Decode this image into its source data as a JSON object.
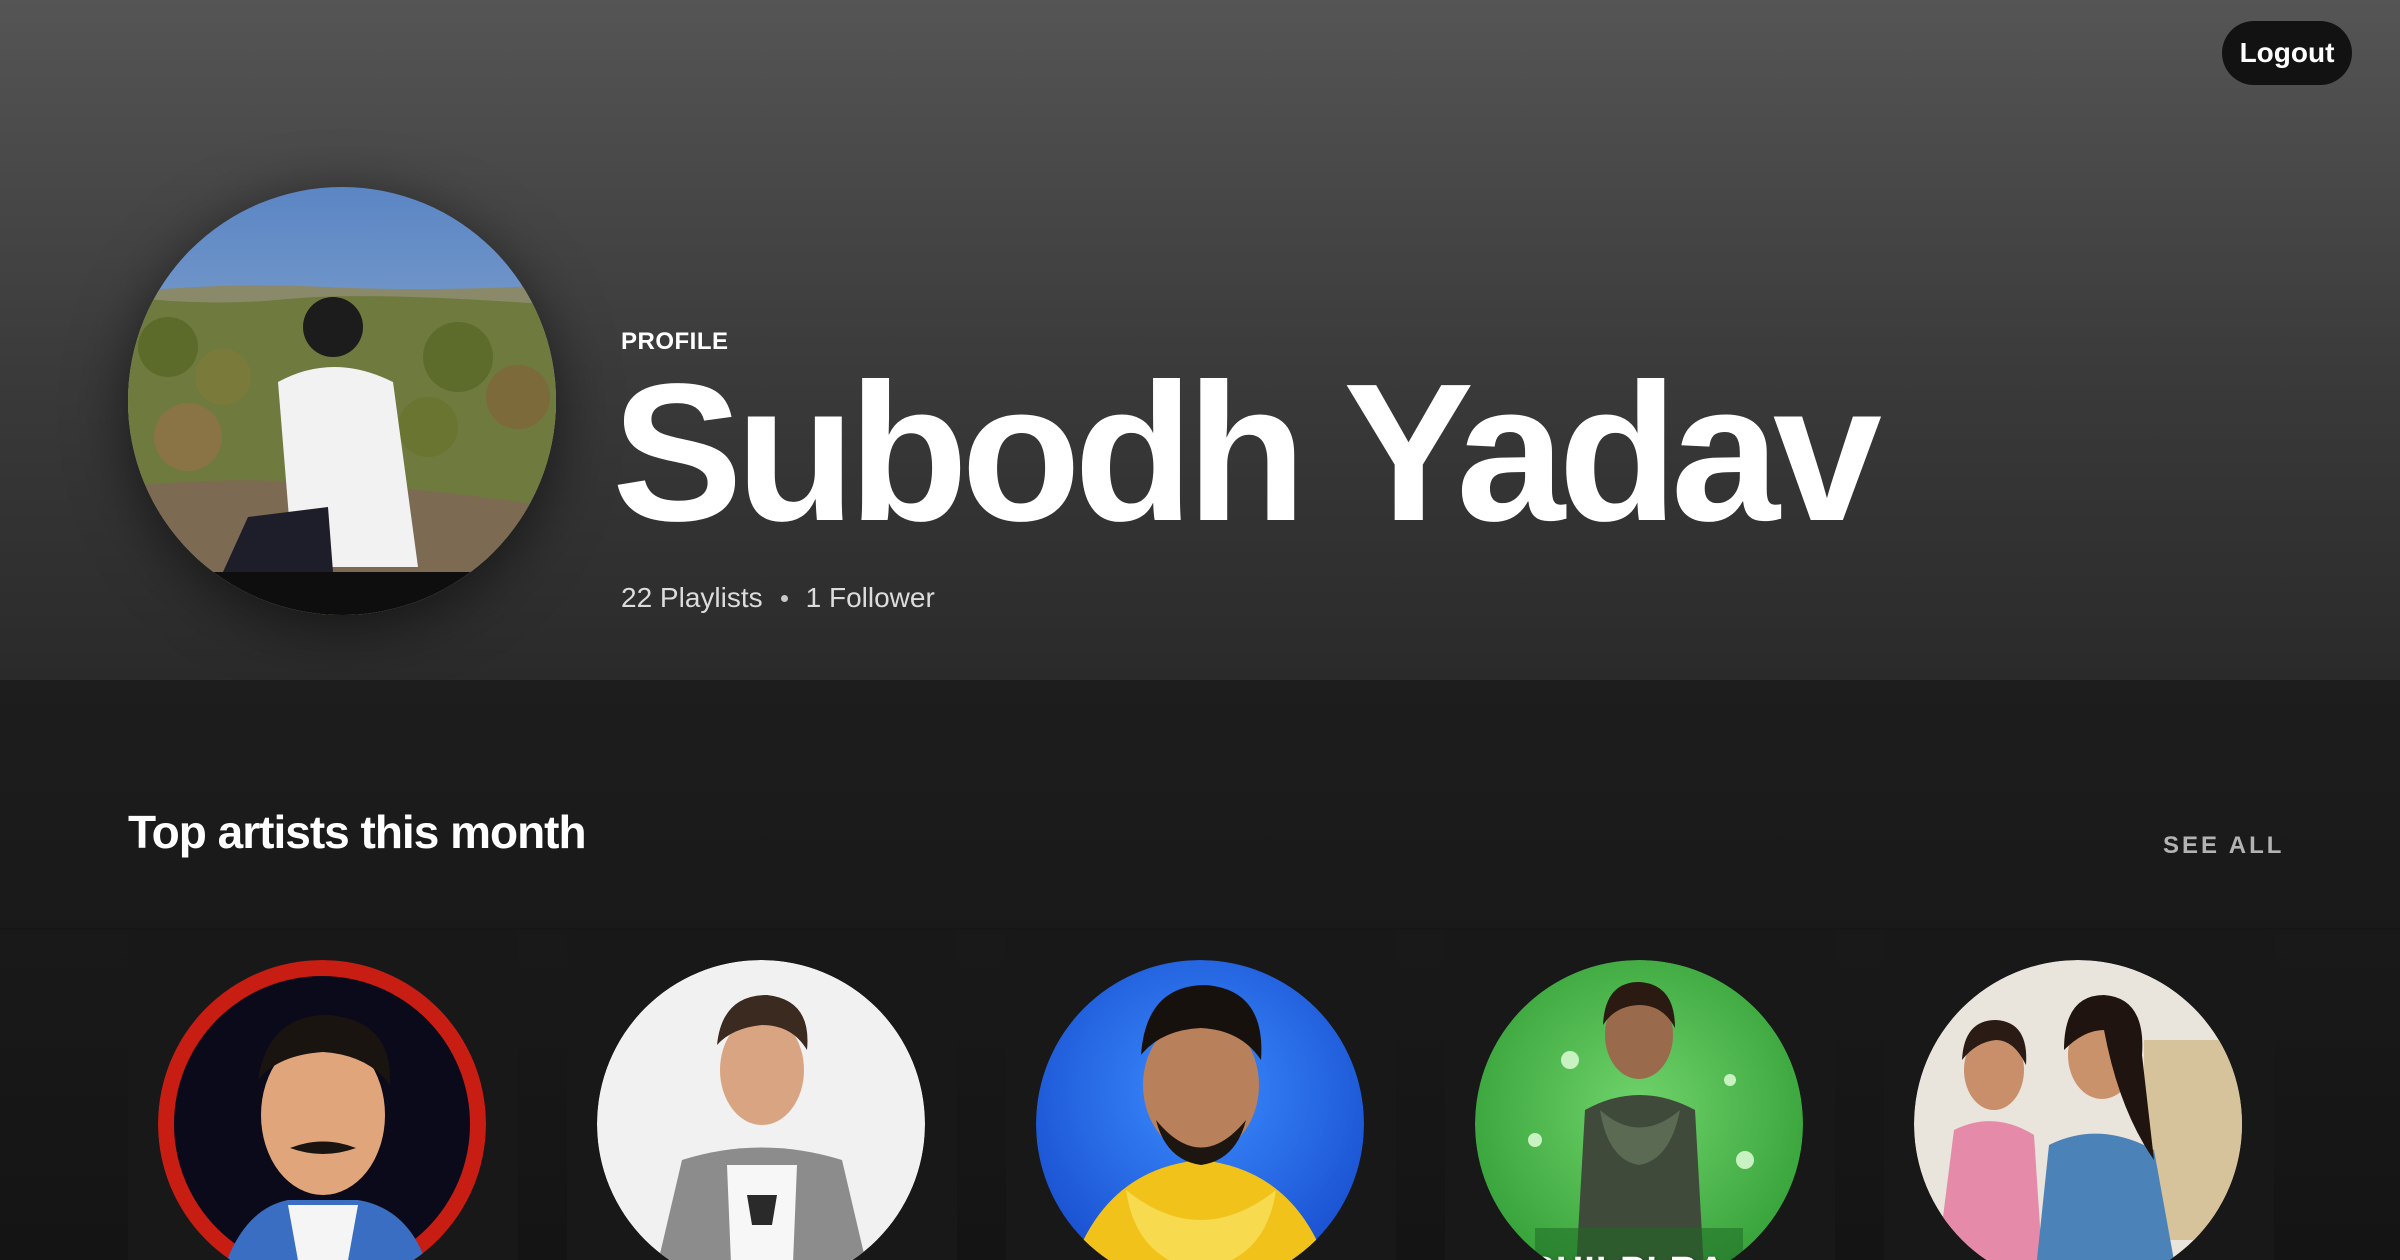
{
  "header": {
    "logout_label": "Logout"
  },
  "profile": {
    "label": "PROFILE",
    "name": "Subodh Yadav",
    "playlists": "22 Playlists",
    "followers": "1 Follower"
  },
  "top_artists": {
    "title": "Top artists this month",
    "see_all_label": "SEE ALL",
    "artists": [
      {
        "image": "artist-portrait-red-ring"
      },
      {
        "image": "artist-portrait-grey-jacket"
      },
      {
        "image": "artist-portrait-blue-bg"
      },
      {
        "image": "artist-portrait-green-bg",
        "image_text": "SHILPI RAJ"
      },
      {
        "image": "artist-portrait-duo"
      }
    ]
  },
  "colors": {
    "background": "#121212",
    "hero_top": "#555555",
    "card": "#181818",
    "button": "#121212",
    "secondary_text": "#b3b3b3"
  }
}
